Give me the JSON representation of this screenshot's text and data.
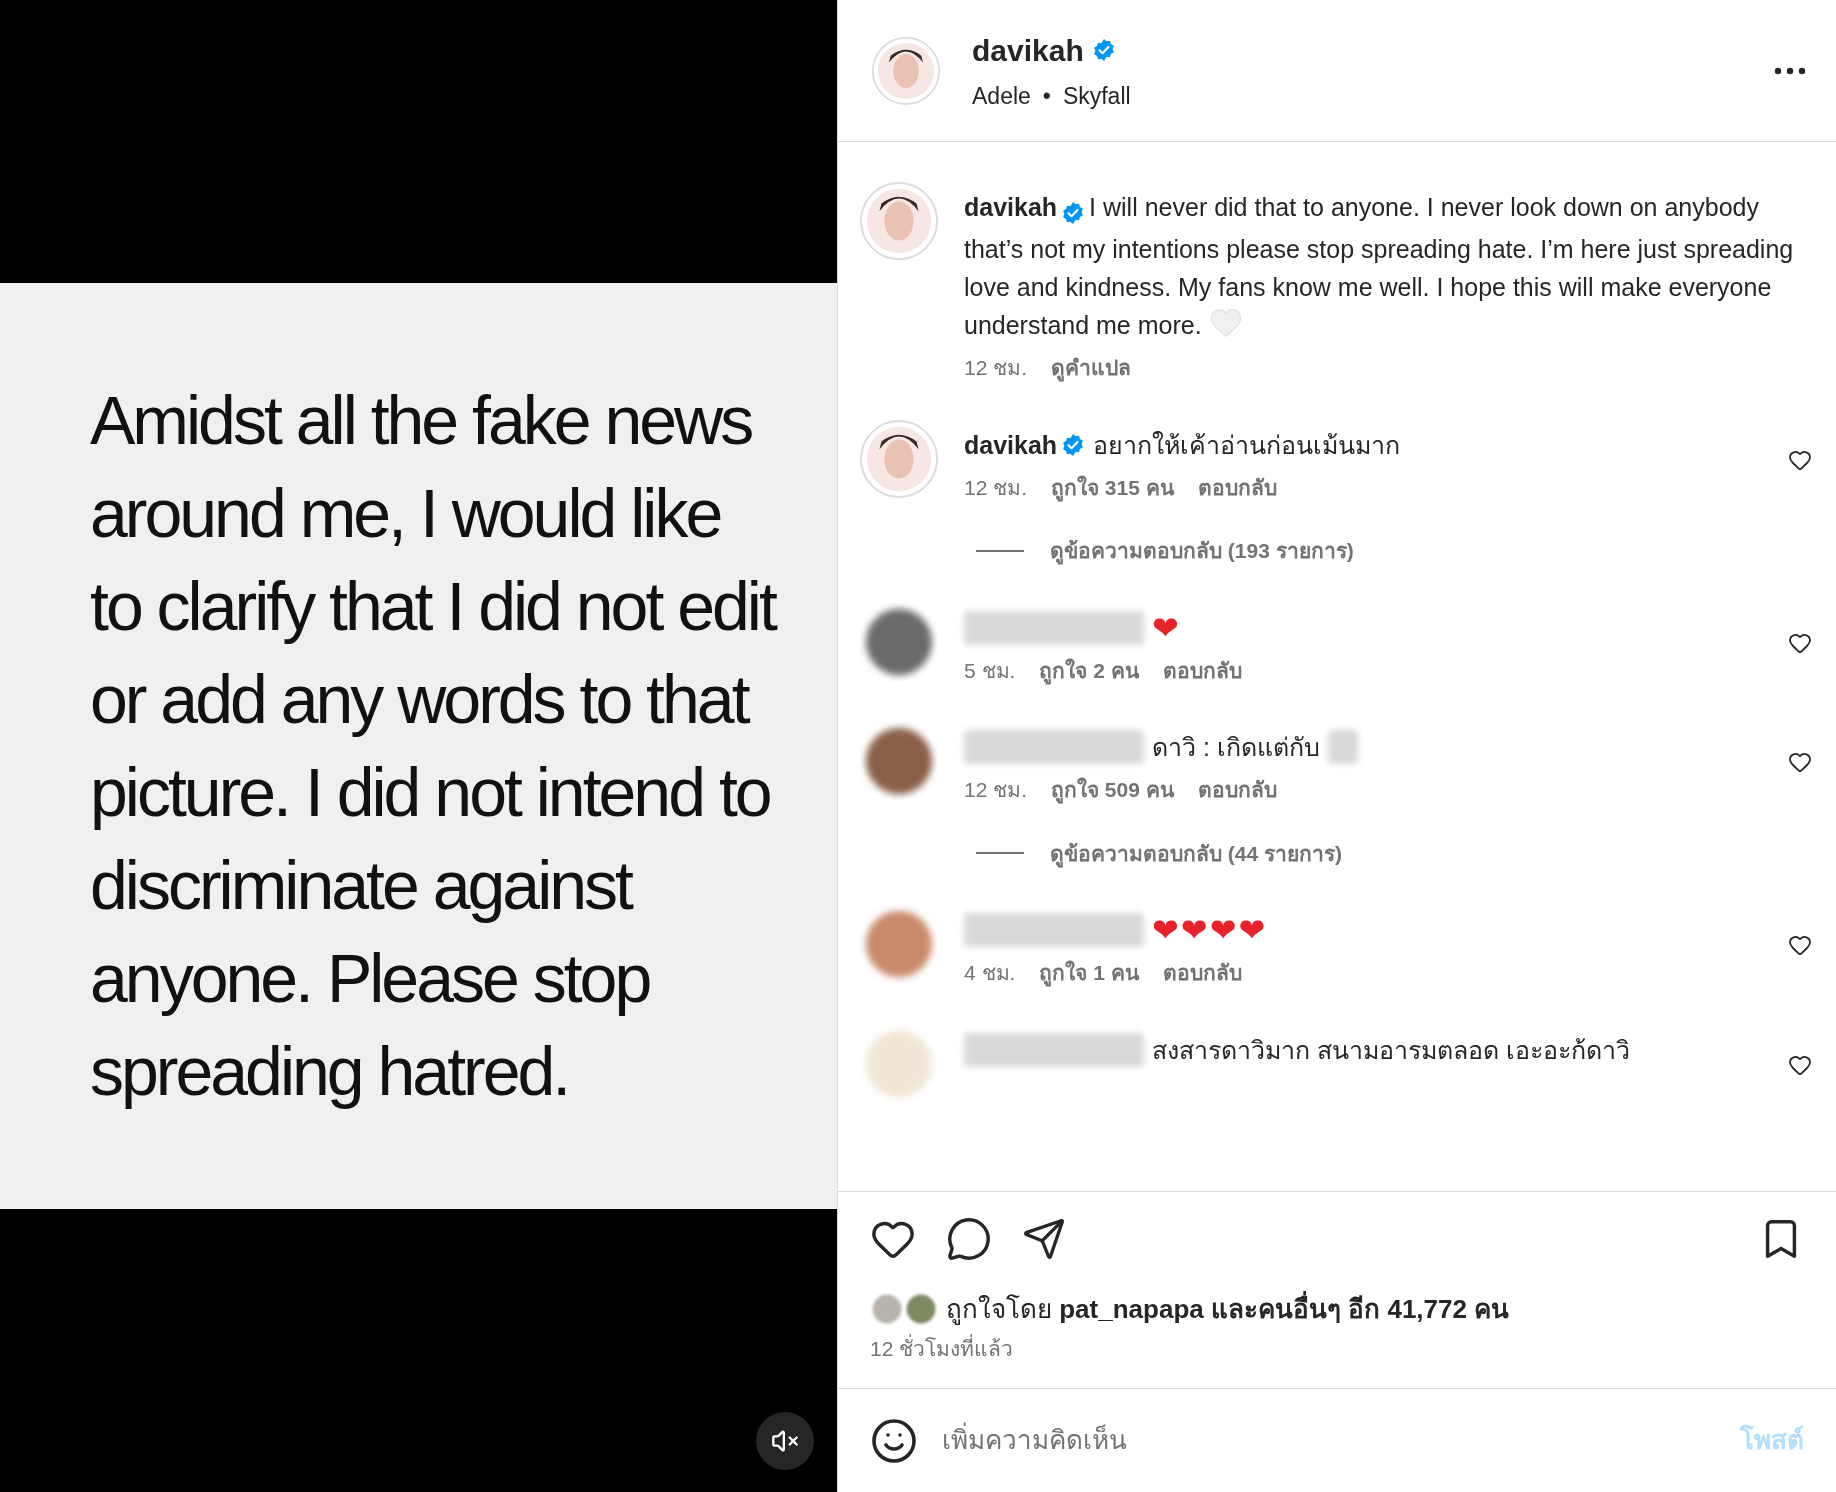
{
  "media": {
    "text": "Amidst all the fake news around me, I would like to clarify that I did not edit or add any words to that picture. I did not intend to discriminate against anyone. Please stop spreading hatred.",
    "muted": true
  },
  "post_header": {
    "username": "davikah",
    "verified": true,
    "audio_artist": "Adele",
    "separator": "•",
    "audio_track": "Skyfall"
  },
  "comments": [
    {
      "kind": "caption",
      "username": "davikah",
      "verified": true,
      "text": "I will never did that to anyone. I never look down on anybody that’s not my intentions please stop spreading hate. I’m here just spreading love and kindness. My fans know me well. I hope this will make everyone understand me more.",
      "trailing_heart": true,
      "time": "12 ชม.",
      "translate": "ดูคำแปล"
    },
    {
      "kind": "comment",
      "username": "davikah",
      "verified": true,
      "text": "อยากให้เค้าอ่านก่อนเม้นมาก",
      "time": "12 ชม.",
      "likes": "ถูกใจ 315 คน",
      "reply": "ตอบกลับ",
      "view_replies": "ดูข้อความตอบกลับ (193 รายการ)"
    },
    {
      "kind": "comment",
      "name_blurred": true,
      "text": "❤",
      "time": "5 ชม.",
      "likes": "ถูกใจ 2 คน",
      "reply": "ตอบกลับ"
    },
    {
      "kind": "comment",
      "name_blurred": true,
      "text": "ดาวิ : เกิดแต่กับ",
      "trailing_blur": true,
      "time": "12 ชม.",
      "likes": "ถูกใจ 509 คน",
      "reply": "ตอบกลับ",
      "view_replies": "ดูข้อความตอบกลับ (44 รายการ)"
    },
    {
      "kind": "comment",
      "name_blurred": true,
      "text": "❤❤❤❤",
      "time": "4 ชม.",
      "likes": "ถูกใจ 1 คน",
      "reply": "ตอบกลับ"
    },
    {
      "kind": "comment",
      "name_blurred": true,
      "text": "สงสารดาวิมาก สนามอารมตลอด เอะอะก้ดาวิ"
    }
  ],
  "likes": {
    "prefix": "ถูกใจโดย",
    "user": "pat_napapa",
    "suffix": "และคนอื่นๆ อีก 41,772 คน"
  },
  "posted_time": "12 ชั่วโมงที่แล้ว",
  "comment_input": {
    "placeholder": "เพิ่มความคิดเห็น"
  },
  "post_button": {
    "label": "โพสต์",
    "disabled": true
  }
}
